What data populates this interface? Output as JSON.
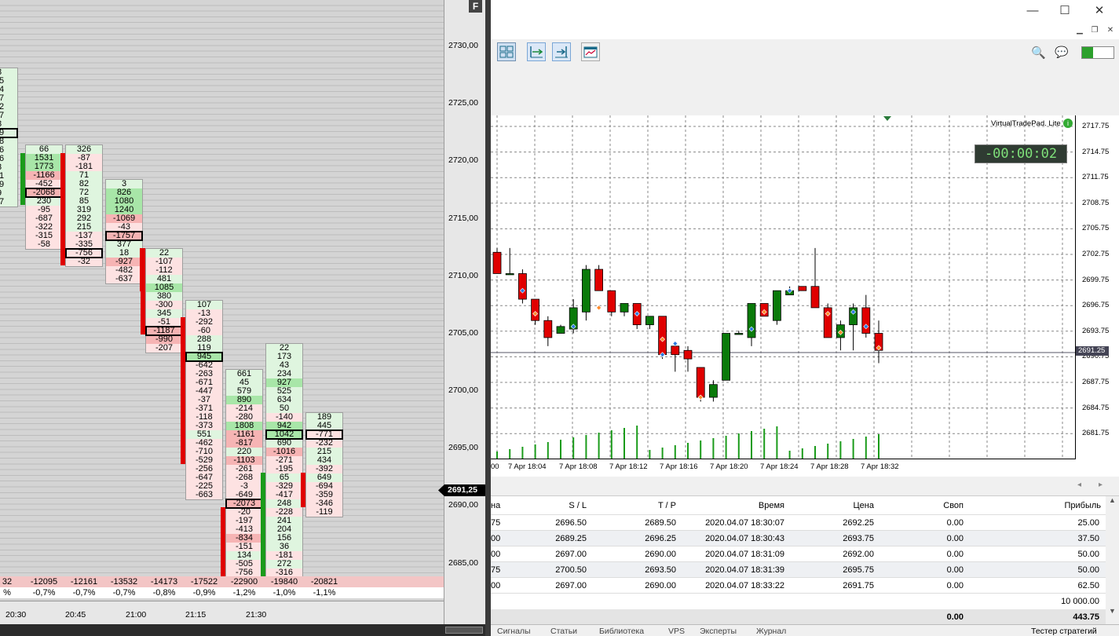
{
  "footprint": {
    "price_labels": [
      "2730,00",
      "2725,00",
      "2720,00",
      "2715,00",
      "2710,00",
      "2705,00",
      "2700,00",
      "2695,00",
      "2690,00",
      "2685,00"
    ],
    "current_price": "2691,25",
    "f_label": "F",
    "time_labels": [
      "20:30",
      "20:45",
      "21:00",
      "21:15",
      "21:30"
    ],
    "column_totals": [
      "32",
      "-12095",
      "-12161",
      "-13532",
      "-14173",
      "-17522",
      "-22900",
      "-19840",
      "-20821"
    ],
    "column_pcts": [
      "%",
      "-0,7%",
      "-0,7%",
      "-0,7%",
      "-0,8%",
      "-0,9%",
      "-1,2%",
      "-1,0%",
      "-1,1%"
    ],
    "columns": [
      [
        "8",
        "05",
        "54",
        "97",
        "02",
        "27",
        "8",
        "39",
        "98",
        "96",
        "16",
        "3",
        "21",
        "59",
        "9",
        "67"
      ],
      [
        "66",
        "1531",
        "1773",
        "-1166",
        "-452",
        "-2068",
        "230",
        "-95",
        "-687",
        "-322",
        "-315",
        "-58"
      ],
      [
        "326",
        "-87",
        "-181",
        "71",
        "82",
        "72",
        "85",
        "319",
        "292",
        "215",
        "-137",
        "-335",
        "-756",
        "-32"
      ],
      [
        "3",
        "826",
        "1080",
        "1240",
        "-1069",
        "-43",
        "-1757",
        "377",
        "18",
        "-927",
        "-482",
        "-637"
      ],
      [
        "22",
        "-107",
        "-112",
        "481",
        "1085",
        "380",
        "-300",
        "345",
        "-51",
        "-1187",
        "-990",
        "-207"
      ],
      [
        "107",
        "-13",
        "-292",
        "-60",
        "288",
        "119",
        "945",
        "-642",
        "-263",
        "-671",
        "-447",
        "-37",
        "-371",
        "-118",
        "-373",
        "551",
        "-462",
        "-710",
        "-529",
        "-256",
        "-647",
        "-225",
        "-663"
      ],
      [
        "661",
        "45",
        "579",
        "890",
        "-214",
        "-280",
        "1808",
        "-1161",
        "-817",
        "220",
        "-1103",
        "-261",
        "-268",
        "-3",
        "-649",
        "-2073",
        "-20",
        "-197",
        "-413",
        "-834",
        "-151",
        "134",
        "-505",
        "-756"
      ],
      [
        "22",
        "173",
        "43",
        "234",
        "927",
        "525",
        "634",
        "50",
        "-140",
        "942",
        "1042",
        "690",
        "-1016",
        "-271",
        "-195",
        "65",
        "-329",
        "-417",
        "248",
        "-228",
        "241",
        "204",
        "156",
        "36",
        "-181",
        "272",
        "-316"
      ],
      [
        "189",
        "445",
        "-771",
        "-232",
        "215",
        "434",
        "-392",
        "649",
        "-694",
        "-359",
        "-346",
        "-119"
      ]
    ]
  },
  "terminal": {
    "window_controls": [
      "—",
      "☐",
      "✕"
    ],
    "timer": "-00:00:02",
    "vtp_label": "VirtualTradePad. Lite",
    "price_scale": [
      "2717.75",
      "2714.75",
      "2711.75",
      "2708.75",
      "2705.75",
      "2702.75",
      "2699.75",
      "2696.75",
      "2693.75",
      "2690.75",
      "2687.75",
      "2684.75",
      "2681.75"
    ],
    "current_price": "2691.25",
    "time_labels": [
      "00",
      "7 Apr 18:04",
      "7 Apr 18:08",
      "7 Apr 18:12",
      "7 Apr 18:16",
      "7 Apr 18:20",
      "7 Apr 18:24",
      "7 Apr 18:28",
      "7 Apr 18:32"
    ],
    "table_headers": [
      "на",
      "S / L",
      "T / P",
      "Время",
      "Цена",
      "Своп",
      "Прибыль"
    ],
    "rows": [
      [
        "75",
        "2696.50",
        "2689.50",
        "2020.04.07 18:30:07",
        "2692.25",
        "0.00",
        "25.00"
      ],
      [
        "00",
        "2689.25",
        "2696.25",
        "2020.04.07 18:30:43",
        "2693.75",
        "0.00",
        "37.50"
      ],
      [
        "00",
        "2697.00",
        "2690.00",
        "2020.04.07 18:31:09",
        "2692.00",
        "0.00",
        "50.00"
      ],
      [
        "75",
        "2700.50",
        "2693.50",
        "2020.04.07 18:31:39",
        "2695.75",
        "0.00",
        "50.00"
      ],
      [
        "00",
        "2697.00",
        "2690.00",
        "2020.04.07 18:33:22",
        "2691.75",
        "0.00",
        "62.50"
      ]
    ],
    "balance": "10 000.00",
    "total_swap": "0.00",
    "total_profit": "443.75",
    "bottom_tabs": [
      "Сигналы",
      "Статьи",
      "Библиотека",
      "VPS",
      "Эксперты",
      "Журнал",
      "Тестер стратегий"
    ]
  }
}
